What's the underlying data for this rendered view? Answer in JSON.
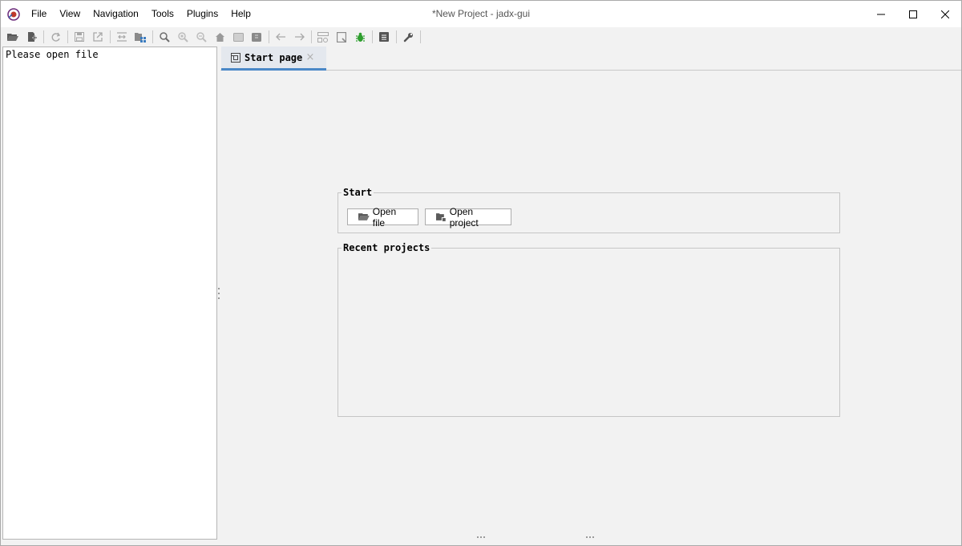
{
  "window": {
    "title": "*New Project - jadx-gui"
  },
  "menu": {
    "items": [
      {
        "label": "File"
      },
      {
        "label": "View"
      },
      {
        "label": "Navigation"
      },
      {
        "label": "Tools"
      },
      {
        "label": "Plugins"
      },
      {
        "label": "Help"
      }
    ]
  },
  "toolbar": {
    "buttons": [
      {
        "icon": "open-folder-icon"
      },
      {
        "icon": "add-files-icon"
      },
      {
        "icon": "reload-icon"
      },
      {
        "icon": "save-icon"
      },
      {
        "icon": "export-icon"
      },
      {
        "icon": "sync-tree-icon"
      },
      {
        "icon": "flatten-packages-icon"
      },
      {
        "icon": "search-icon"
      },
      {
        "icon": "search-class-icon"
      },
      {
        "icon": "search-usage-icon"
      },
      {
        "icon": "home-icon"
      },
      {
        "icon": "comments-icon"
      },
      {
        "icon": "bookmark-icon"
      },
      {
        "icon": "back-arrow-icon"
      },
      {
        "icon": "forward-arrow-icon"
      },
      {
        "icon": "deobfuscation-icon"
      },
      {
        "icon": "quark-icon"
      },
      {
        "icon": "debug-bug-icon"
      },
      {
        "icon": "log-viewer-icon"
      },
      {
        "icon": "preferences-wrench-icon"
      }
    ]
  },
  "tree": {
    "placeholder": "Please open file"
  },
  "tabs": [
    {
      "label": "Start page",
      "icon": "start-page-icon",
      "active": true
    }
  ],
  "start_page": {
    "start_group_title": "Start",
    "open_file_label": "Open file",
    "open_project_label": "Open project",
    "recent_group_title": "Recent projects",
    "recent_projects": []
  },
  "colors": {
    "tab_accent": "#4a88c7",
    "debug_icon": "#2e9e2e",
    "app_icon": "#c0392b"
  }
}
